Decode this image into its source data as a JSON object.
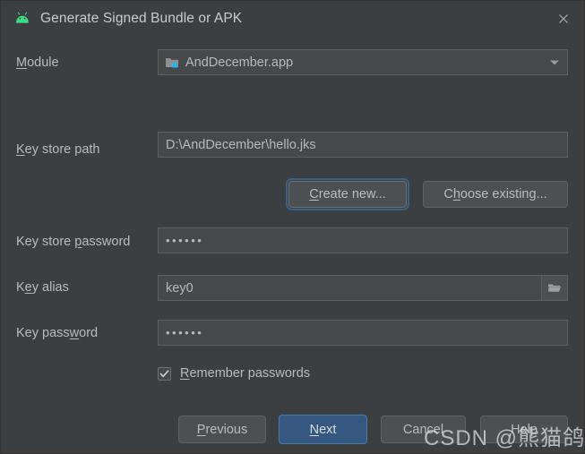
{
  "window": {
    "title": "Generate Signed Bundle or APK",
    "app_icon": "android-icon",
    "close_icon": "close-icon"
  },
  "form": {
    "module": {
      "label_pre": "M",
      "label_post": "odule",
      "value": "AndDecember.app",
      "icon": "module-folder-icon",
      "arrow_icon": "chevron-down-icon"
    },
    "key_store_path": {
      "label_pre": "K",
      "label_post": "ey store path",
      "value": "D:\\AndDecember\\hello.jks"
    },
    "key_store_password": {
      "label_a": "Key store ",
      "label_mn": "p",
      "label_b": "assword",
      "value": "••••••"
    },
    "key_alias": {
      "label_a": "K",
      "label_mn": "e",
      "label_b": "y alias",
      "value": "key0",
      "browse_icon": "folder-open-icon"
    },
    "key_password": {
      "label_a": "Key pass",
      "label_mn": "w",
      "label_b": "ord",
      "value": "••••••"
    },
    "remember_passwords": {
      "label_mn": "R",
      "label_rest": "emember passwords",
      "checked": true,
      "check_icon": "checkmark-icon"
    }
  },
  "keystore_buttons": {
    "create_new": {
      "mn": "C",
      "rest": "reate new..."
    },
    "choose_existing": {
      "a": "C",
      "mn": "h",
      "b": "oose existing..."
    }
  },
  "bottom_buttons": {
    "previous": {
      "mn": "P",
      "rest": "revious"
    },
    "next": {
      "mn": "N",
      "rest": "ext"
    },
    "cancel": {
      "a": "Cancel"
    },
    "help": {
      "a": "Help"
    }
  },
  "watermark": {
    "text": "CSDN @熊猫鸽子汤"
  },
  "colors": {
    "dialog_bg": "#3c3f41",
    "field_bg": "#45494a",
    "button_bg": "#4c5052",
    "primary_button_bg": "#365880",
    "focus_ring": "#3d6185",
    "android_green": "#3ddc84",
    "module_accent": "#2ab5e8",
    "text": "#bbbbbb"
  }
}
